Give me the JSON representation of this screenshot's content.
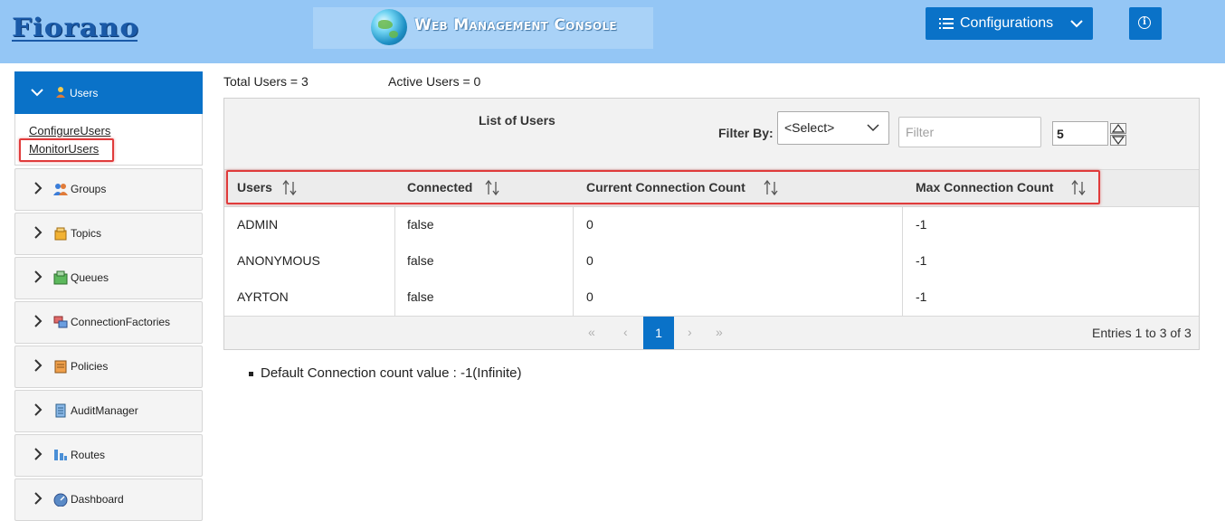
{
  "header": {
    "logo_text": "Fiorano",
    "console_title": "Web Management Console",
    "configurations_label": "Configurations",
    "info_glyph": "i"
  },
  "sidebar": {
    "items": [
      {
        "label": "Users",
        "icon": "user-icon",
        "expanded": true,
        "sub_items": [
          {
            "label": "ConfigureUsers"
          },
          {
            "label": "MonitorUsers"
          }
        ]
      },
      {
        "label": "Groups",
        "icon": "groups-icon"
      },
      {
        "label": "Topics",
        "icon": "topics-icon"
      },
      {
        "label": "Queues",
        "icon": "queues-icon"
      },
      {
        "label": "ConnectionFactories",
        "icon": "connection-factories-icon"
      },
      {
        "label": "Policies",
        "icon": "policies-icon"
      },
      {
        "label": "AuditManager",
        "icon": "audit-manager-icon"
      },
      {
        "label": "Routes",
        "icon": "routes-icon"
      },
      {
        "label": "Dashboard",
        "icon": "dashboard-icon"
      }
    ]
  },
  "stats": {
    "total_users": "Total Users = 3",
    "active_users": "Active Users = 0"
  },
  "table": {
    "title": "List of Users",
    "filter_by_label": "Filter By:",
    "select_value": "<Select>",
    "filter_placeholder": "Filter",
    "page_size": "5",
    "columns": [
      "Users",
      "Connected",
      "Current Connection Count",
      "Max Connection Count"
    ],
    "rows": [
      [
        "ADMIN",
        "false",
        "0",
        "-1"
      ],
      [
        "ANONYMOUS",
        "false",
        "0",
        "-1"
      ],
      [
        "AYRTON",
        "false",
        "0",
        "-1"
      ]
    ],
    "pagination": {
      "first": "«",
      "prev": "‹",
      "current": "1",
      "next": "›",
      "last": "»",
      "entries": "Entries 1 to 3 of 3"
    }
  },
  "note": "Default Connection count value : -1(Infinite)",
  "colors": {
    "header_bg": "#94c6f5",
    "primary_blue": "#0a72c8",
    "highlight_red": "#e03b3b"
  }
}
